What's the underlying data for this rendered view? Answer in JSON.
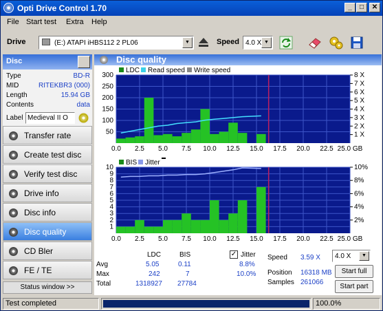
{
  "app": {
    "title": "Opti Drive Control 1.70"
  },
  "menu": [
    "File",
    "Start test",
    "Extra",
    "Help"
  ],
  "toolbar": {
    "drive_label": "Drive",
    "drive_value": "(E:)   ATAPI iHBS112   2 PL06",
    "speed_label": "Speed",
    "speed_value": "4.0 X"
  },
  "disc": {
    "header": "Disc",
    "rows": [
      {
        "k": "Type",
        "v": "BD-R"
      },
      {
        "k": "MID",
        "v": "RITEKBR3 (000)"
      },
      {
        "k": "Length",
        "v": "15.94 GB"
      },
      {
        "k": "Contents",
        "v": "data"
      }
    ],
    "label_key": "Label",
    "label_value": "Medieval II O"
  },
  "nav": [
    "Transfer rate",
    "Create test disc",
    "Verify test disc",
    "Drive info",
    "Disc info",
    "Disc quality",
    "CD Bler",
    "FE / TE"
  ],
  "nav_active": "Disc quality",
  "status_window": "Status window >>",
  "main": {
    "title": "Disc quality"
  },
  "chart_top": {
    "legend": [
      "LDC",
      "Read speed",
      "Write speed"
    ],
    "y_left": [
      "300",
      "250",
      "200",
      "150",
      "100",
      "50"
    ],
    "y_right": [
      "8 X",
      "7 X",
      "6 X",
      "5 X",
      "4 X",
      "3 X",
      "2 X",
      "1 X"
    ],
    "x": [
      "0.0",
      "2.5",
      "5.0",
      "7.5",
      "10.0",
      "12.5",
      "15.0",
      "17.5",
      "20.0",
      "22.5",
      "25.0 GB"
    ]
  },
  "chart_bottom": {
    "legend": [
      "BIS",
      "Jitter"
    ],
    "y_left": [
      "10",
      "9",
      "8",
      "7",
      "6",
      "5",
      "4",
      "3",
      "2",
      "1"
    ],
    "y_right": [
      "10%",
      "8%",
      "6%",
      "4%",
      "2%"
    ],
    "x": [
      "0.0",
      "2.5",
      "5.0",
      "7.5",
      "10.0",
      "12.5",
      "15.0",
      "17.5",
      "20.0",
      "22.5",
      "25.0 GB"
    ]
  },
  "chart_data": [
    {
      "type": "bar",
      "series": [
        {
          "name": "LDC",
          "values": [
            20,
            25,
            30,
            200,
            35,
            40,
            30,
            45,
            60,
            150,
            40,
            50,
            90,
            45,
            40
          ]
        },
        {
          "name": "Read speed",
          "values": [
            1.2,
            1.4,
            1.6,
            1.8,
            2.0,
            2.1,
            2.3,
            2.4,
            2.5,
            2.7,
            2.8,
            2.9,
            3.0,
            3.1,
            3.2
          ]
        }
      ],
      "x": [
        0.5,
        1.5,
        2.5,
        3.5,
        4.5,
        5.5,
        6.5,
        7.5,
        8.5,
        9.5,
        10.5,
        11.5,
        12.5,
        13.5,
        15.5
      ],
      "ylim": [
        0,
        300
      ]
    },
    {
      "type": "bar",
      "series": [
        {
          "name": "BIS",
          "values": [
            1,
            1,
            2,
            1,
            1,
            2,
            2,
            3,
            2,
            2,
            5,
            2,
            3,
            5,
            7
          ]
        },
        {
          "name": "Jitter",
          "values": [
            8.5,
            8.6,
            8.6,
            8.7,
            8.7,
            8.8,
            8.8,
            8.9,
            8.9,
            9.0,
            9.2,
            9.4,
            9.6,
            9.9,
            9.8
          ]
        }
      ],
      "x": [
        0.5,
        1.5,
        2.5,
        3.5,
        4.5,
        5.5,
        6.5,
        7.5,
        8.5,
        9.5,
        10.5,
        11.5,
        12.5,
        13.5,
        15.5
      ],
      "ylim": [
        0,
        10
      ]
    }
  ],
  "stats": {
    "col_ldc": "LDC",
    "col_bis": "BIS",
    "avg_label": "Avg",
    "avg_ldc": "5.05",
    "avg_bis": "0.11",
    "max_label": "Max",
    "max_ldc": "242",
    "max_bis": "7",
    "total_label": "Total",
    "total_ldc": "1318927",
    "total_bis": "27784",
    "jitter_label": "Jitter",
    "jitter_avg": "8.8%",
    "jitter_max": "10.0%",
    "speed_label": "Speed",
    "speed_value": "3.59 X",
    "speed_combo": "4.0 X",
    "position_label": "Position",
    "position_value": "16318 MB",
    "samples_label": "Samples",
    "samples_value": "261066",
    "start_full": "Start full",
    "start_part": "Start part"
  },
  "status": {
    "text": "Test completed",
    "progress": 1.0,
    "percent": "100.0%"
  }
}
